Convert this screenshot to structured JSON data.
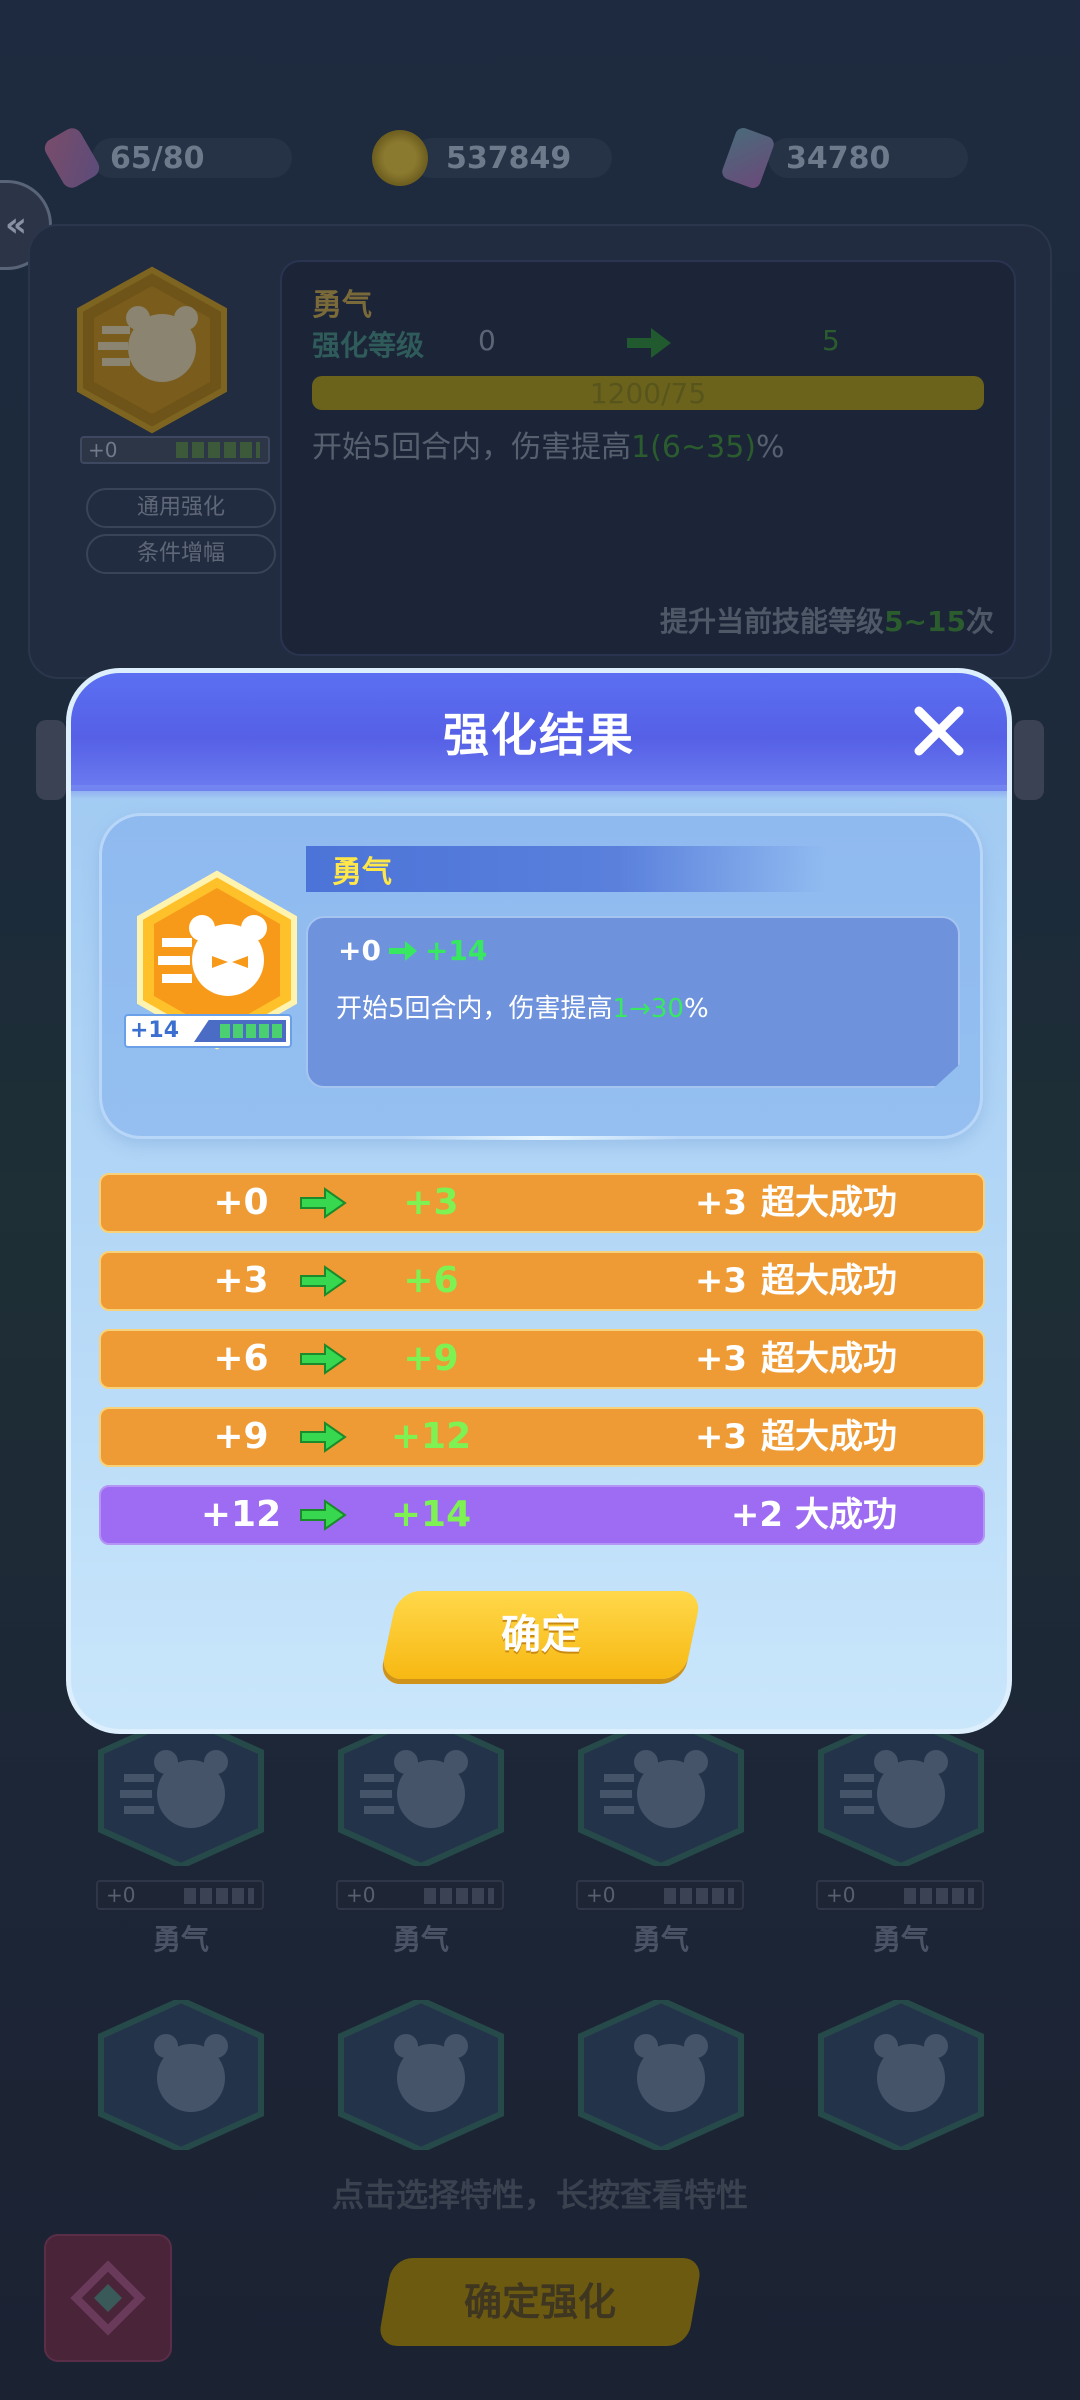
{
  "resources": {
    "tickets": "65/80",
    "coins": "537849",
    "gems": "34780"
  },
  "skill_panel": {
    "name": "勇气",
    "level_label": "强化等级",
    "level_from": "0",
    "level_to": "5",
    "progress_text": "1200/75",
    "desc_prefix": "开始5回合内，伤害提高",
    "desc_value": "1(6~35)",
    "desc_suffix": "%",
    "footer_prefix": "提升当前技能等级",
    "footer_value": "5~15",
    "footer_suffix": "次",
    "badge_level": "+0",
    "btn_general": "通用强化",
    "btn_condition": "条件增幅"
  },
  "grid": {
    "items": [
      {
        "level": "+0",
        "name": "勇气"
      },
      {
        "level": "+0",
        "name": "勇气"
      },
      {
        "level": "+0",
        "name": "勇气"
      },
      {
        "level": "+0",
        "name": "勇气"
      }
    ],
    "hint": "点击选择特性，长按查看特性",
    "confirm_label": "确定强化"
  },
  "modal": {
    "title": "强化结果",
    "skill": {
      "name": "勇气",
      "badge_level": "+14",
      "level_from": "+0",
      "level_to": "+14",
      "desc_prefix": "开始5回合内，伤害提高",
      "desc_from": "1",
      "desc_arrow": "→",
      "desc_to": "30",
      "desc_suffix": "%"
    },
    "results": [
      {
        "from": "+0",
        "to": "+3",
        "delta": "+3",
        "label": "超大成功",
        "type": "super"
      },
      {
        "from": "+3",
        "to": "+6",
        "delta": "+3",
        "label": "超大成功",
        "type": "super"
      },
      {
        "from": "+6",
        "to": "+9",
        "delta": "+3",
        "label": "超大成功",
        "type": "super"
      },
      {
        "from": "+9",
        "to": "+12",
        "delta": "+3",
        "label": "超大成功",
        "type": "super"
      },
      {
        "from": "+12",
        "to": "+14",
        "delta": "+2",
        "label": "大成功",
        "type": "great"
      }
    ],
    "ok_label": "确定"
  },
  "colors": {
    "header": "#5b6ff2",
    "super_row": "#ee9b35",
    "great_row": "#9e6cf2",
    "green": "#37e860",
    "gold": "#ffe74a"
  }
}
